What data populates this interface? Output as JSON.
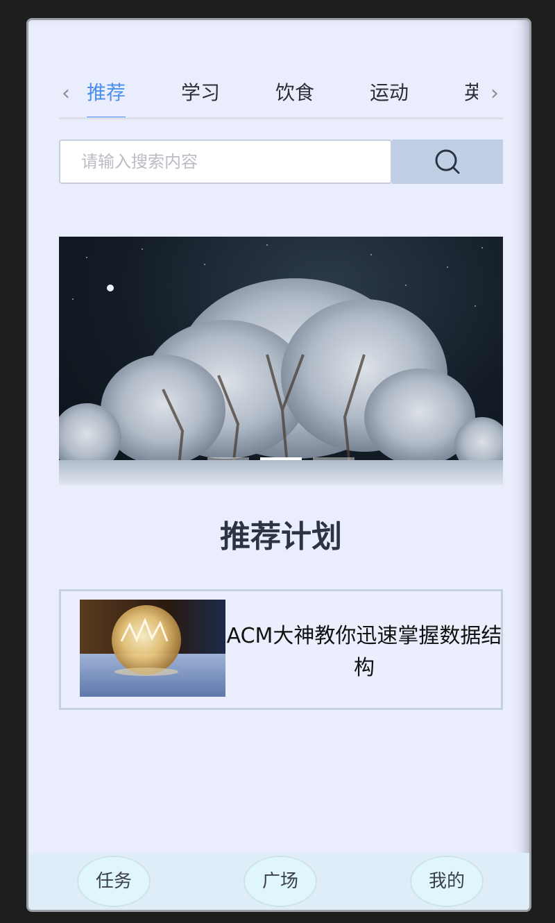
{
  "tabs": {
    "items": [
      "推荐",
      "学习",
      "饮食",
      "运动",
      "英"
    ],
    "active_index": 0,
    "prev_icon": "chevron-left-icon",
    "next_icon": "chevron-right-icon"
  },
  "search": {
    "placeholder": "请输入搜索内容",
    "value": "",
    "button_icon": "search-icon"
  },
  "banner": {
    "image": "snowy-trees-night-photo",
    "slides": 3,
    "active_slide": 1
  },
  "section": {
    "title": "推荐计划"
  },
  "plans": [
    {
      "title": "ACM大神教你迅速掌握数据结构",
      "thumbnail": "frozen-bubble-photo"
    }
  ],
  "bottom_nav": {
    "items": [
      "任务",
      "广场",
      "我的"
    ]
  },
  "colors": {
    "background": "#e9edfc",
    "accent": "#4a8ff0",
    "search_button": "#c1cfe4",
    "bottom_nav": "#dfedf9"
  }
}
